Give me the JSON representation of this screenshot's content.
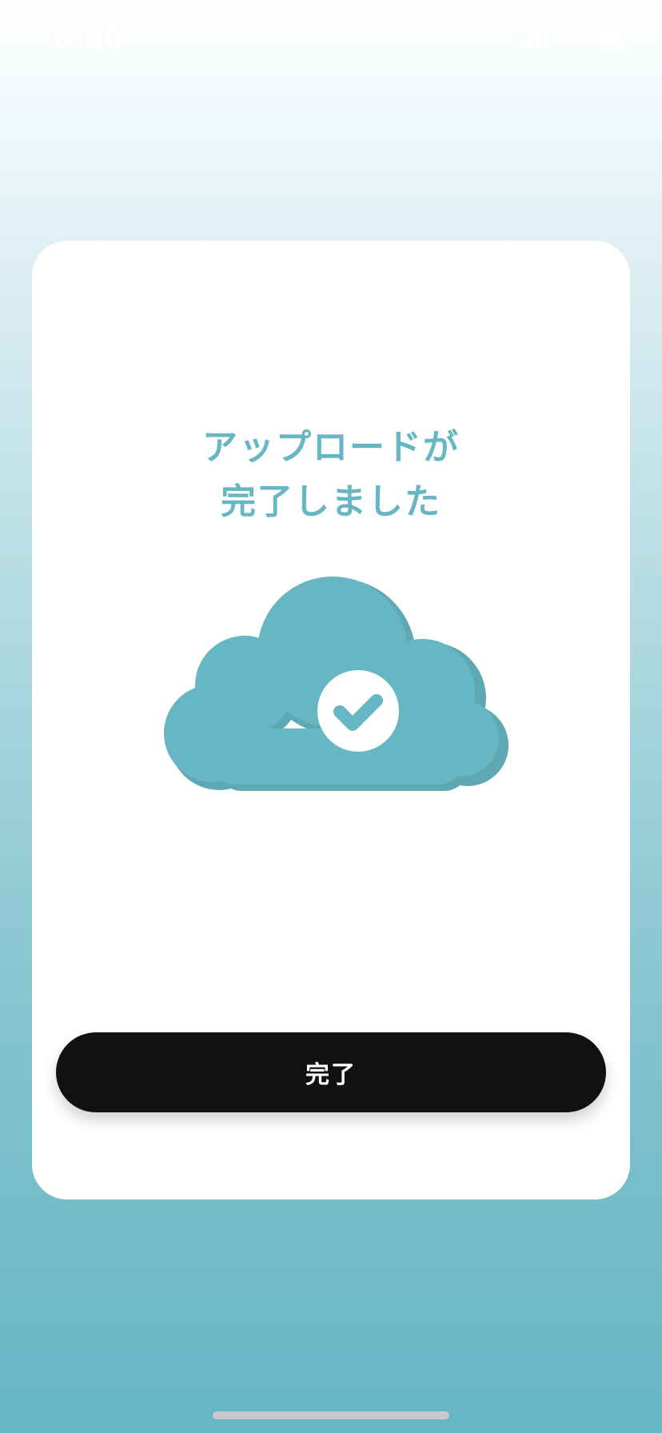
{
  "status_bar": {
    "time": "6:00",
    "icons": [
      "cellular-signal-icon",
      "wifi-icon",
      "battery-icon"
    ]
  },
  "dialog": {
    "title_line1": "アップロードが",
    "title_line2": "完了しました",
    "illustration": "cloud-check-icon",
    "done_button_label": "完了"
  },
  "colors": {
    "accent": "#66b6c4",
    "button": "#111111",
    "button_text": "#ffffff",
    "card": "#ffffff"
  }
}
